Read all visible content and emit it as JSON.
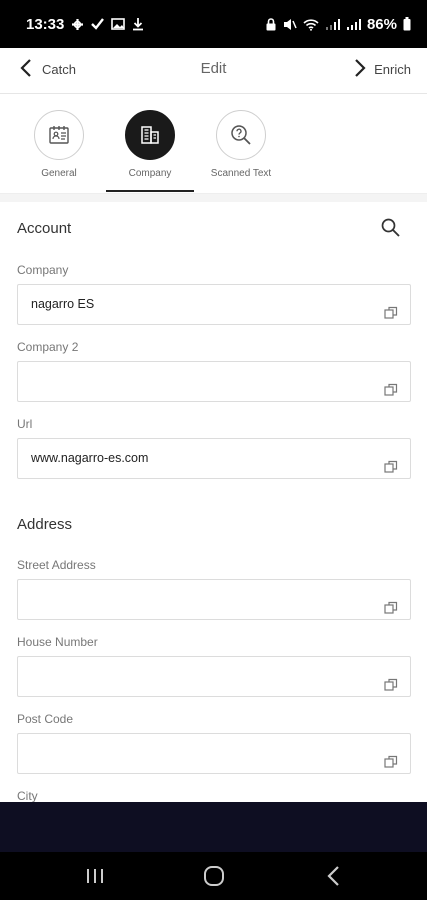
{
  "status_bar": {
    "time": "13:33",
    "battery": "86%"
  },
  "header": {
    "back_label": "Catch",
    "title": "Edit",
    "forward_label": "Enrich"
  },
  "tabs": [
    {
      "label": "General",
      "icon": "contact-card-icon",
      "active": false
    },
    {
      "label": "Company",
      "icon": "building-icon",
      "active": true
    },
    {
      "label": "Scanned Text",
      "icon": "scan-search-icon",
      "active": false
    }
  ],
  "account": {
    "title": "Account",
    "fields": [
      {
        "label": "Company",
        "value": "nagarro ES"
      },
      {
        "label": "Company 2",
        "value": ""
      },
      {
        "label": "Url",
        "value": "www.nagarro-es.com"
      }
    ]
  },
  "address": {
    "title": "Address",
    "fields": [
      {
        "label": "Street Address",
        "value": ""
      },
      {
        "label": "House Number",
        "value": ""
      },
      {
        "label": "Post Code",
        "value": ""
      },
      {
        "label": "City",
        "value": ""
      }
    ]
  },
  "colors": {
    "active_tab": "#1a1a1a",
    "dark_band": "#0e0e22",
    "border": "#dcdcdc"
  }
}
